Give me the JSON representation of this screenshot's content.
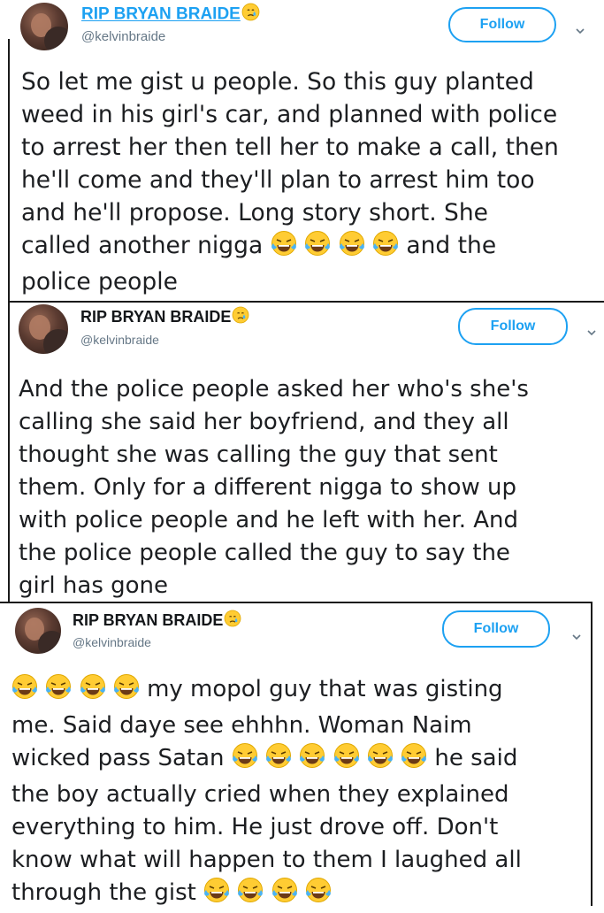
{
  "accent_color": "#1da1f2",
  "tweets": [
    {
      "display_name": "RIP BRYAN BRAIDE",
      "handle": "@kelvinbraide",
      "follow_label": "Follow",
      "lines": [
        "So let me gist u people. So this guy planted",
        "weed in his girl's car, and planned with police",
        "to arrest her then tell her to make a call, then",
        "he'll come and they'll plan to arrest him too",
        "and he'll propose. Long story short. She",
        "called another nigga",
        "and the",
        "police people"
      ]
    },
    {
      "display_name": "RIP BRYAN BRAIDE",
      "handle": "@kelvinbraide",
      "follow_label": "Follow",
      "lines": [
        "And the police people asked her who's she's",
        "calling she said her boyfriend, and they all",
        "thought she was calling the guy that sent",
        "them. Only for a different nigga to show up",
        "with police people and he left with her. And",
        "the police people called the guy to say the",
        "girl has gone"
      ]
    },
    {
      "display_name": "RIP BRYAN BRAIDE",
      "handle": "@kelvinbraide",
      "follow_label": "Follow",
      "lines": [
        "my mopol guy that was gisting",
        "me. Said daye see ehhhn. Woman Naim",
        "wicked pass Satan",
        "he said",
        "the boy actually cried when they explained",
        "everything to him. He just drove off. Don't",
        "know what will happen to them I laughed all",
        "through the gist"
      ]
    }
  ],
  "icons": {
    "name_emoji": "crying-face-icon",
    "laugh_emoji": "tears-of-joy-icon",
    "caret": "chevron-down-icon"
  }
}
